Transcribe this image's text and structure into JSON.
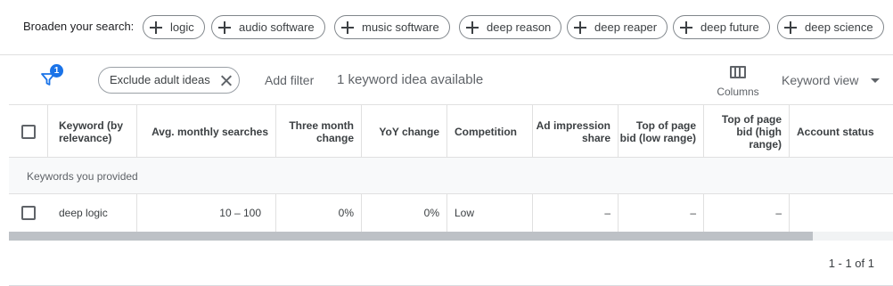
{
  "broaden": {
    "label": "Broaden your search:",
    "chips": [
      "logic",
      "audio software",
      "music software",
      "deep reason",
      "deep reaper",
      "deep future",
      "deep science"
    ]
  },
  "filter_bar": {
    "filter_count": "1",
    "exclude_chip": "Exclude adult ideas",
    "add_filter": "Add filter",
    "ideas_count": "1 keyword idea available",
    "columns_label": "Columns",
    "view_label": "Keyword view"
  },
  "table": {
    "headers": {
      "keyword": "Keyword (by relevance)",
      "avg": "Avg. monthly searches",
      "three_month": "Three month change",
      "yoy": "YoY change",
      "competition": "Competition",
      "ad_share": "Ad impression share",
      "top_low": "Top of page bid (low range)",
      "top_high": "Top of page bid (high range)",
      "account_status": "Account status"
    },
    "group_label": "Keywords you provided",
    "rows": [
      {
        "keyword": "deep logic",
        "avg": "10 – 100",
        "three_month": "0%",
        "yoy": "0%",
        "competition": "Low",
        "ad_share": "–",
        "top_low": "–",
        "top_high": "–",
        "account_status": ""
      }
    ]
  },
  "pager": "1 - 1 of 1",
  "colors": {
    "accent": "#1a73e8",
    "text": "#3c4043",
    "muted": "#5f6368"
  }
}
